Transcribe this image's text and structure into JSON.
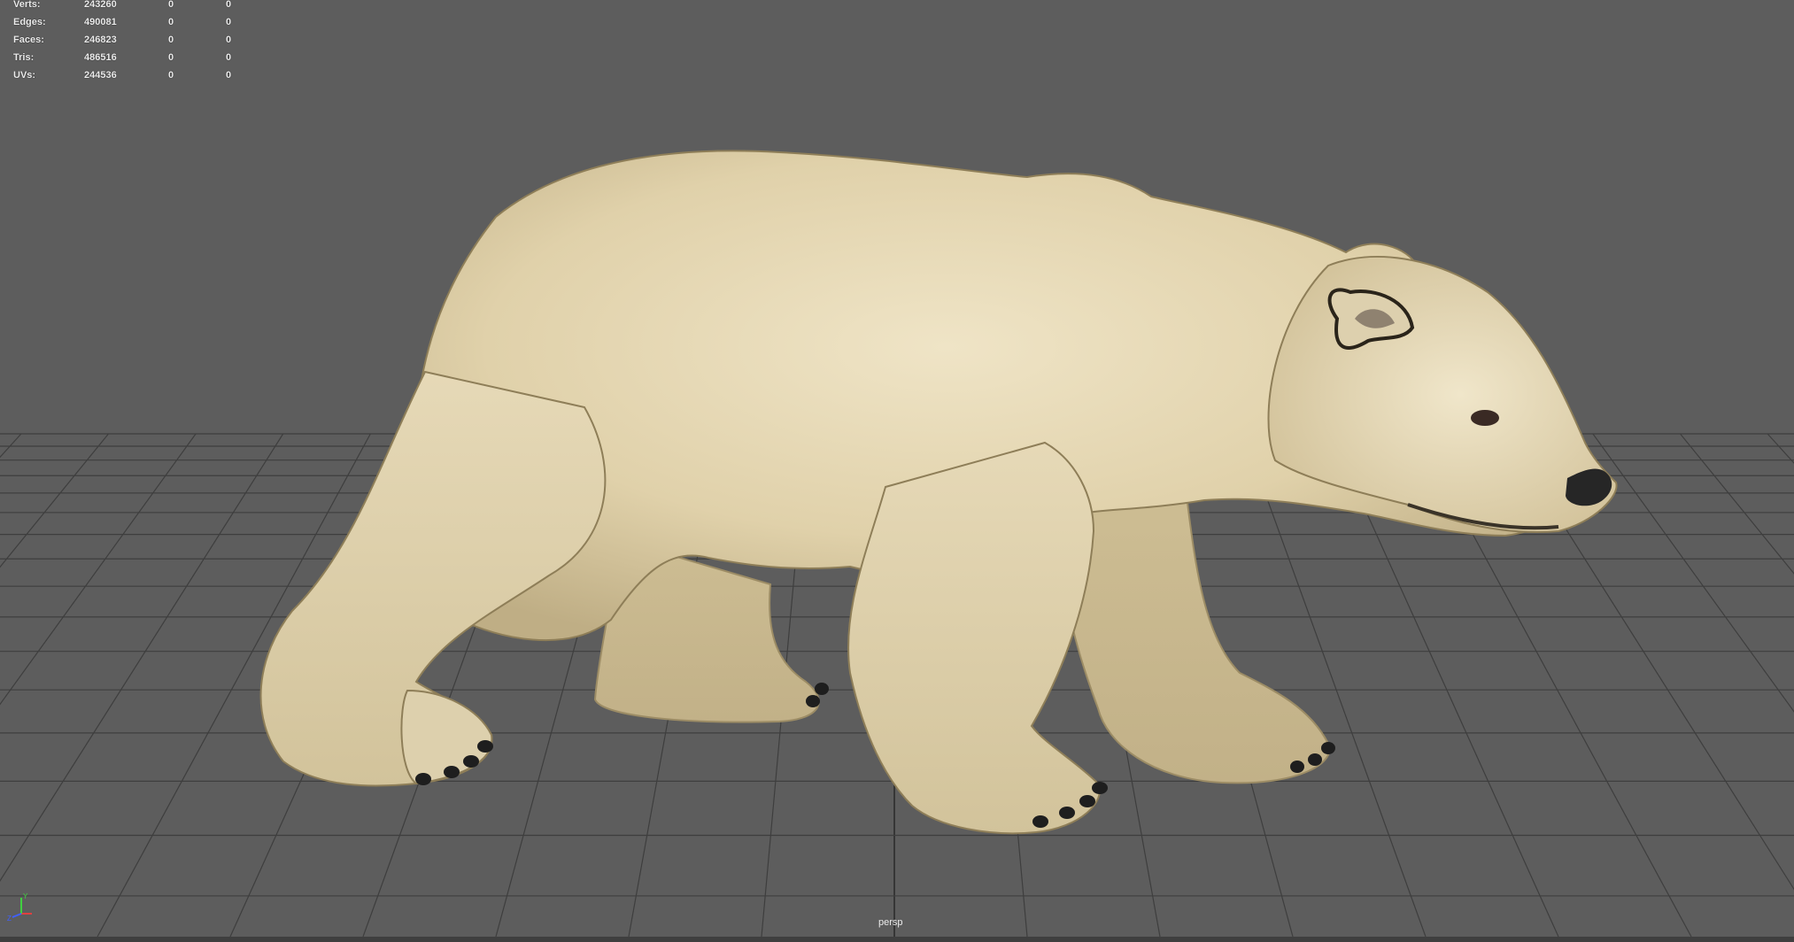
{
  "hud": {
    "rows": [
      {
        "label": "Verts:",
        "total": "243260",
        "selected": "0",
        "component": "0"
      },
      {
        "label": "Edges:",
        "total": "490081",
        "selected": "0",
        "component": "0"
      },
      {
        "label": "Faces:",
        "total": "246823",
        "selected": "0",
        "component": "0"
      },
      {
        "label": "Tris:",
        "total": "486516",
        "selected": "0",
        "component": "0"
      },
      {
        "label": "UVs:",
        "total": "244536",
        "selected": "0",
        "component": "0"
      }
    ]
  },
  "viewport": {
    "camera_label": "persp",
    "background_color": "#5d5d5d",
    "grid_color": "#3e3e3e",
    "grid_axis_color": "#1c1c1c"
  },
  "axis_gizmo": {
    "x_label": "X",
    "y_label": "Y",
    "z_label": "Z",
    "x_color": "#e04040",
    "y_color": "#40d040",
    "z_color": "#4060ff"
  },
  "model": {
    "name": "polar bear",
    "fur_color": "#e3d6b3",
    "claw_color": "#1e1e1e"
  }
}
